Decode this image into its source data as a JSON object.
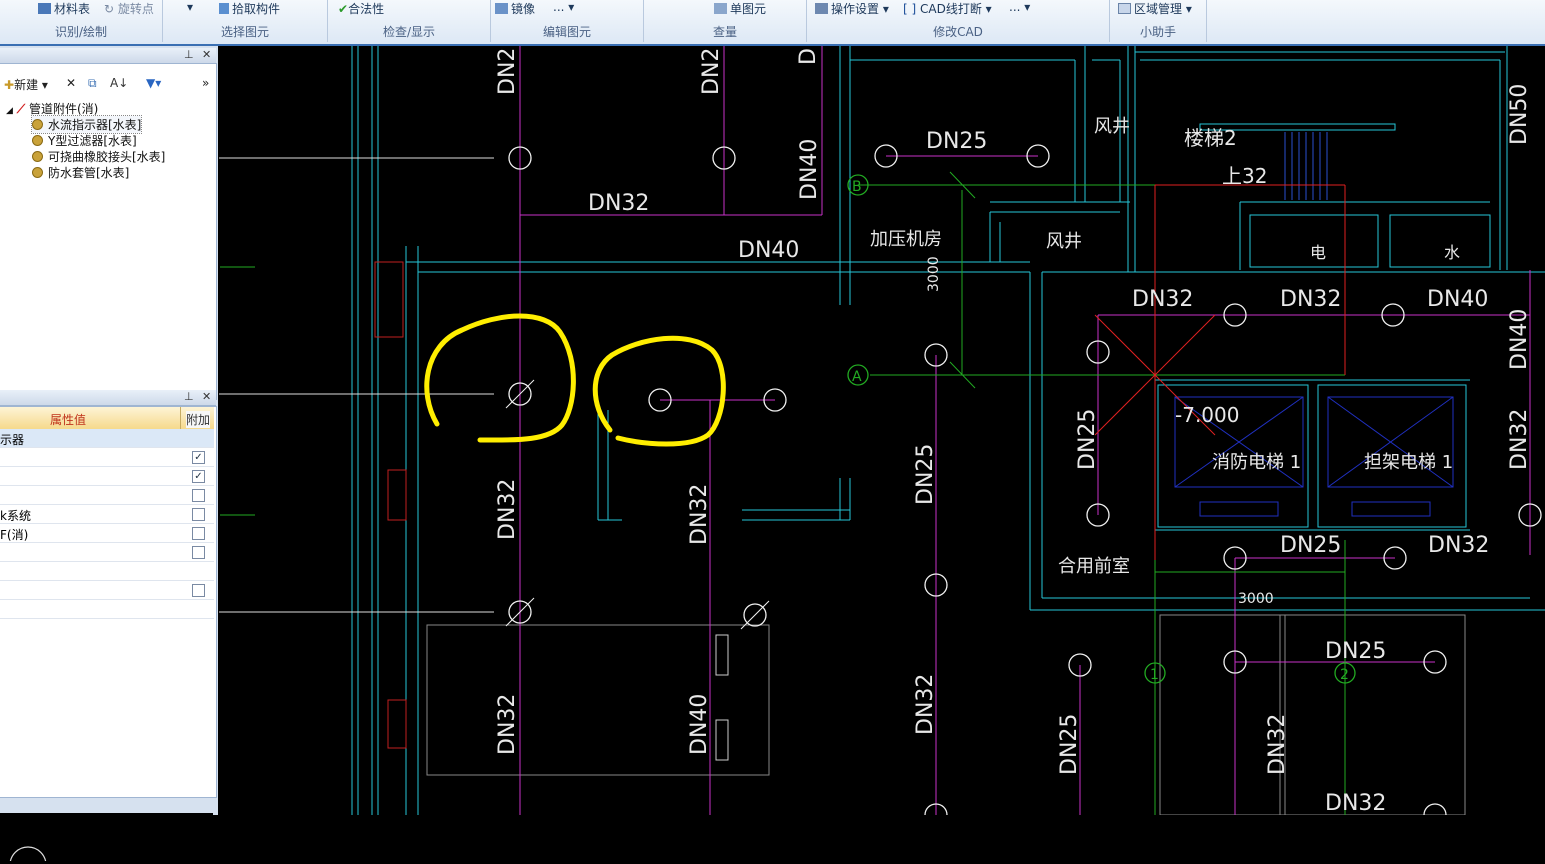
{
  "ribbon": {
    "groups": [
      {
        "label": "识别/绘制",
        "buttons": [
          "材料表",
          "旋转点"
        ]
      },
      {
        "label": "选择图元",
        "buttons": [
          "拾取构件"
        ]
      },
      {
        "label": "检查/显示",
        "buttons": [
          "合法性"
        ]
      },
      {
        "label": "编辑图元",
        "buttons": [
          "镜像",
          "..."
        ]
      },
      {
        "label": "查量",
        "buttons": [
          "单图元"
        ]
      },
      {
        "label": "修改CAD",
        "buttons": [
          "操作设置",
          "CAD线打断",
          "..."
        ]
      },
      {
        "label": "小助手",
        "buttons": [
          "区域管理"
        ]
      }
    ]
  },
  "tree": {
    "toolbar": {
      "new_label": "新建"
    },
    "root": "管道附件(消)",
    "items": [
      "水流指示器[水表]",
      "Y型过滤器[水表]",
      "可挠曲橡胶接头[水表]",
      "防水套管[水表]"
    ]
  },
  "props": {
    "header_value": "属性值",
    "header_extra": "附加",
    "rows": [
      {
        "value": "示器",
        "extra": ""
      },
      {
        "value": "",
        "extra": "checked"
      },
      {
        "value": "",
        "extra": "checked"
      },
      {
        "value": "",
        "extra": "unchecked"
      },
      {
        "value": "k系统",
        "extra": "unchecked"
      },
      {
        "value": "F(消)",
        "extra": "unchecked"
      },
      {
        "value": "",
        "extra": "unchecked"
      },
      {
        "value": "",
        "extra": ""
      },
      {
        "value": "",
        "extra": "unchecked"
      },
      {
        "value": "",
        "extra": ""
      }
    ]
  },
  "cad": {
    "colors": {
      "wall": "#26c6d8",
      "pipe": "#c832c8",
      "text": "#e8e8e8",
      "axis": "#22aa22",
      "annot": "#ffee00",
      "red": "#e02020"
    },
    "labels": {
      "dn32_a": "DN32",
      "dn40_a": "DN40",
      "dn25_a": "DN25",
      "dn40_b": "DN40",
      "jiaya": "加压机房",
      "fengjing1": "风井",
      "fengjing2": "风井",
      "louti": "楼梯2",
      "shang": "上32",
      "dian": "电",
      "shui": "水",
      "dn32_b": "DN32",
      "dn32_c": "DN32",
      "dn40_c": "DN40",
      "dn50": "DN50",
      "dn40_d": "DN40",
      "dn32_d": "DN32",
      "dn25_b": "DN25",
      "elev": "-7.000",
      "xiaofang": "消防电梯 1",
      "bajia": "担架电梯 1",
      "heyong": "合用前室",
      "dn25_c": "DN25",
      "dn32_e": "DN32",
      "dim3000a": "3000",
      "dim3000b": "3000",
      "dn25_d": "DN25",
      "dn32_f": "DN32",
      "dn32_g": "DN32",
      "dn25_e": "DN25",
      "dn32_h": "DN32",
      "dn32_i": "DN32",
      "dn40_e": "DN40",
      "dn32_j": "DN32",
      "dn25_f": "DN25",
      "dn32_k": "DN32",
      "axisA": "A",
      "axisB": "B",
      "axis1": "1",
      "axis2": "2",
      "dn2x_a": "DN2",
      "dn2x_b": "DN2",
      "dn2x_c": "DN"
    }
  }
}
